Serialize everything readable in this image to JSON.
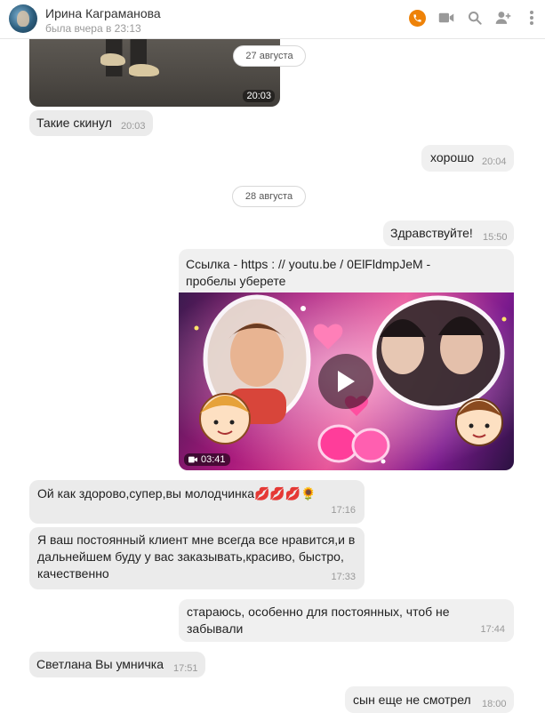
{
  "header": {
    "name": "Ирина Каграманова",
    "status": "была вчера в 23:13",
    "icons": [
      "phone-icon",
      "video-icon",
      "search-icon",
      "add-user-icon",
      "more-icon"
    ],
    "accent": "#ee8208"
  },
  "media_top": {
    "time": "20:03"
  },
  "dates": [
    "27 августа",
    "28 августа"
  ],
  "messages": [
    {
      "side": "in",
      "text": "Такие скинул",
      "time": "20:03"
    },
    {
      "side": "out",
      "text": "хорошо",
      "time": "20:04"
    },
    {
      "side": "out",
      "text": "Здравствуйте!",
      "time": "15:50"
    },
    {
      "side": "in",
      "text": "Ой как здорово,супер,вы молодчинка💋💋💋🌻",
      "time": "17:16"
    },
    {
      "side": "in",
      "text": "Я ваш постоянный клиент мне всегда все нравится,и в дальнейшем буду у вас заказывать,красиво, быстро, качественно",
      "time": "17:33"
    },
    {
      "side": "out",
      "text": "стараюсь, особенно для постоянных, чтоб не забывали",
      "time": "17:44"
    },
    {
      "side": "in",
      "text": "Светлана Вы умничка",
      "time": "17:51"
    },
    {
      "side": "out",
      "text": "сын еще не смотрел",
      "time": "18:00"
    }
  ],
  "link_card": {
    "text_line1": "Ссылка - https  :  //  youtu.be  /   0ElFldmpJeM -",
    "text_line2": "пробелы уберете",
    "video_duration": "03:41"
  }
}
